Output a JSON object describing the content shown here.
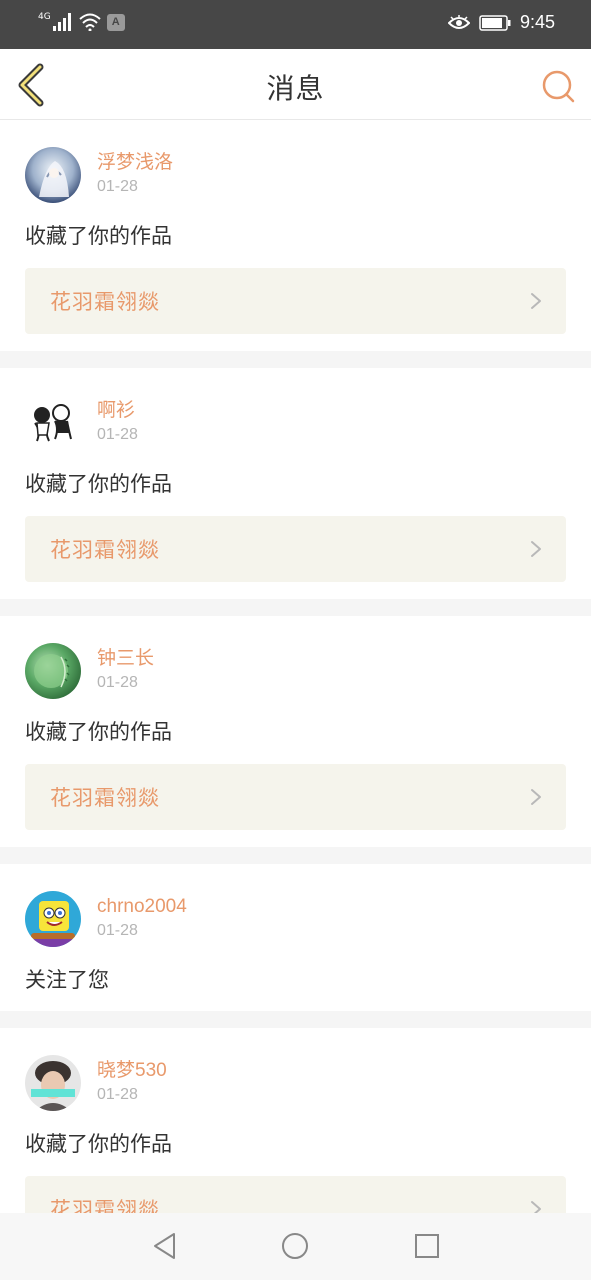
{
  "status_bar": {
    "network": "4G",
    "badge": "A",
    "time": "9:45"
  },
  "header": {
    "title": "消息",
    "back_icon": "chevron-left-icon",
    "search_icon": "search-icon"
  },
  "messages": [
    {
      "username": "浮梦浅洛",
      "date": "01-28",
      "action": "收藏了你的作品",
      "work_title": "花羽霜翎燚",
      "avatar_icon": "avatar-anime-girl"
    },
    {
      "username": "啊衫",
      "date": "01-28",
      "action": "收藏了你的作品",
      "work_title": "花羽霜翎燚",
      "avatar_icon": "avatar-cartoon-couple"
    },
    {
      "username": "钟三长",
      "date": "01-28",
      "action": "收藏了你的作品",
      "work_title": "花羽霜翎燚",
      "avatar_icon": "avatar-green-melon"
    },
    {
      "username": "chrno2004",
      "date": "01-28",
      "action": "关注了您",
      "avatar_icon": "avatar-spongebob"
    },
    {
      "username": "晓梦530",
      "date": "01-28",
      "action": "收藏了你的作品",
      "work_title": "花羽霜翎燚",
      "avatar_icon": "avatar-person"
    }
  ],
  "colors": {
    "accent": "#e8996b",
    "work_box_bg": "#f5f4ec",
    "status_bar_bg": "#474747"
  }
}
